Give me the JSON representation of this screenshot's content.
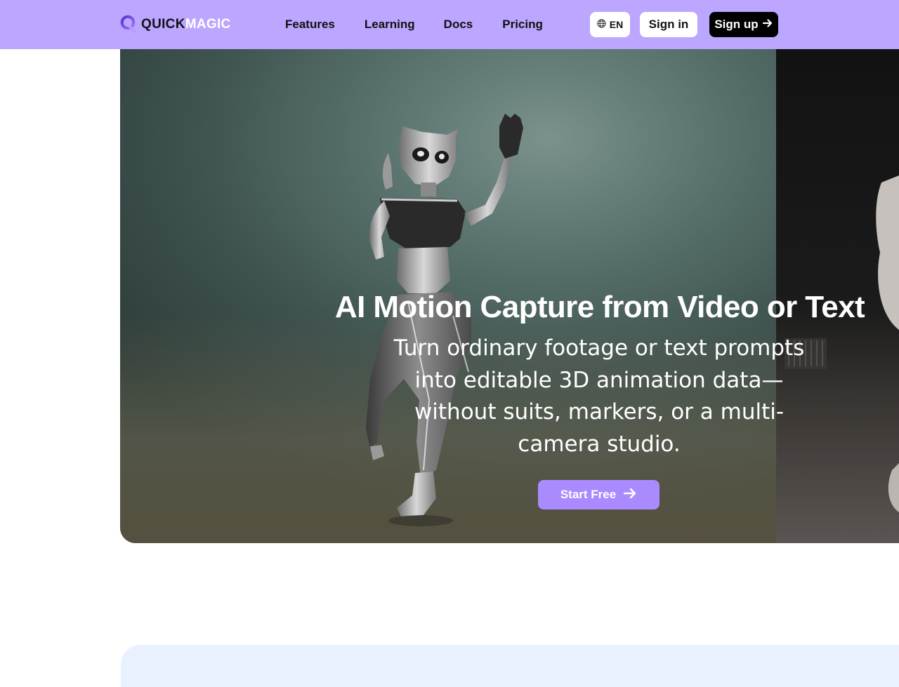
{
  "header": {
    "logo": {
      "word_dark": "QUICK",
      "word_light": "MAGIC"
    },
    "nav": [
      "Features",
      "Learning",
      "Docs",
      "Pricing"
    ],
    "language": {
      "label": "EN",
      "icon": "globe-icon"
    },
    "sign_in": "Sign in",
    "sign_up": {
      "label": "Sign up",
      "icon": "arrow-right-icon"
    }
  },
  "hero": {
    "title": "AI Motion Capture from Video or Text",
    "subtitle": "Turn ordinary footage or text prompts into editable 3D animation data—without suits, markers, or a multi-camera studio.",
    "cta": {
      "label": "Start Free",
      "icon": "arrow-right-icon"
    }
  },
  "colors": {
    "header_bg": "#bca6ff",
    "accent": "#a98bff",
    "hero_bg": "#566f6a",
    "sign_up_bg": "#000000",
    "next_section_bg": "#eaf1fe"
  }
}
